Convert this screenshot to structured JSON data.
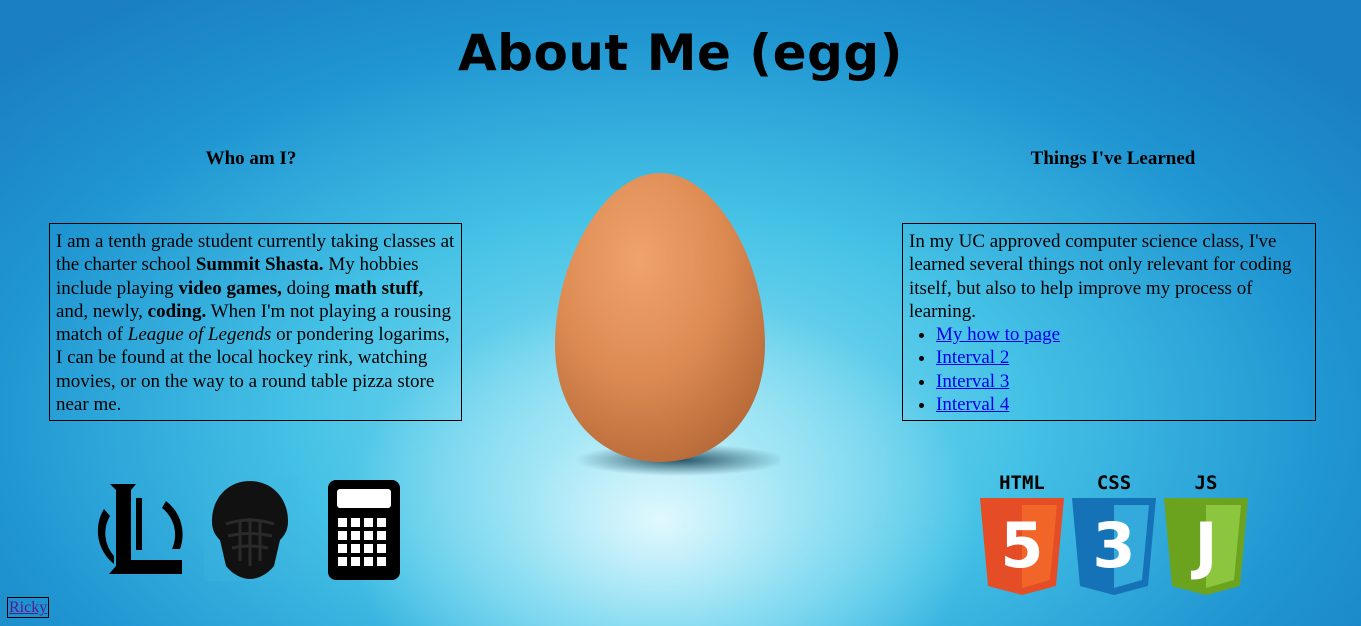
{
  "page": {
    "title": "About Me (egg)"
  },
  "left": {
    "heading": "Who am I?",
    "text": {
      "p1": "I am a tenth grade student currently taking classes at the charter school ",
      "b1": "Summit Shasta.",
      "p2": " My hobbies include playing ",
      "b2": "video games,",
      "p3": " doing ",
      "b3": "math stuff,",
      "p4": " and, newly, ",
      "b4": "coding.",
      "p5": " When I'm not playing a rousing match of ",
      "i1": "League of Legends",
      "p6": " or pondering logarims, I can be found at the local hockey rink, watching movies, or on the way to a round table pizza store near me."
    },
    "icons": [
      "league-of-legends-logo",
      "hockey-goalie-mask-icon",
      "calculator-icon"
    ]
  },
  "right": {
    "heading": "Things I've Learned",
    "intro": "In my UC approved computer science class, I've learned several things not only relevant for coding itself, but also to help improve my process of learning.",
    "links": [
      "My how to page",
      "Interval 2",
      "Interval 3",
      "Interval 4"
    ],
    "badges": {
      "html": {
        "label": "HTML",
        "number": "5",
        "color": "#e44d26"
      },
      "css": {
        "label": "CSS",
        "number": "3",
        "color": "#1572b6"
      },
      "js": {
        "label": "JS",
        "number": "J",
        "color": "#6ba31f"
      }
    }
  },
  "center": {
    "image": "egg-photo"
  },
  "footer": {
    "link": "Ricky"
  }
}
